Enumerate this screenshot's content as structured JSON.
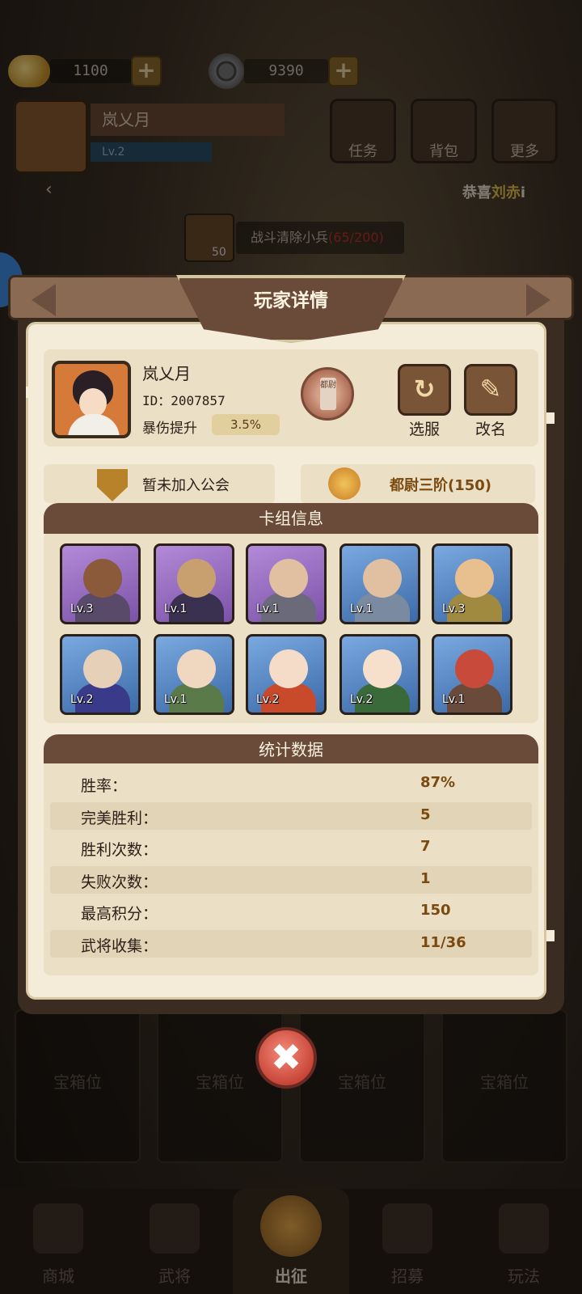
{
  "resources": {
    "gold": "1100",
    "coins": "9390",
    "plus": "+"
  },
  "player_bar": {
    "name": "岚乂月",
    "level": "Lv.2"
  },
  "top_buttons": {
    "task": "任务",
    "bag": "背包",
    "more": "更多"
  },
  "notice": {
    "prefix": "恭喜",
    "highlight": "刘赤",
    "suffix": "i",
    "left_arrow": "‹"
  },
  "quest": {
    "count": "50",
    "text": "战斗清除小兵",
    "progress": "(65/200)"
  },
  "dialog": {
    "title": "玩家详情",
    "player": {
      "name": "岚乂月",
      "id": "ID：2007857",
      "crit_label": "暴伤提升",
      "crit_value": "3.5%",
      "seal_text": "都尉"
    },
    "buttons": {
      "select_server": "选服",
      "rename": "改名",
      "select_server_icon": "↻",
      "rename_icon": "✎"
    },
    "guild": "暂未加入公会",
    "rank": "都尉三阶(150)",
    "deck": {
      "title": "卡组信息",
      "heroes": [
        {
          "level": "Lv.3",
          "rarity": "purple",
          "skin": "#8a5a3a",
          "armor": "#5a4a6a"
        },
        {
          "level": "Lv.1",
          "rarity": "purple",
          "skin": "#c8a070",
          "armor": "#3a3050"
        },
        {
          "level": "Lv.1",
          "rarity": "purple",
          "skin": "#e0c0a0",
          "armor": "#6a6a7a"
        },
        {
          "level": "Lv.1",
          "rarity": "blue",
          "skin": "#e0c0a0",
          "armor": "#7a8aa0"
        },
        {
          "level": "Lv.3",
          "rarity": "blue",
          "skin": "#e8c090",
          "armor": "#a08a40"
        },
        {
          "level": "Lv.2",
          "rarity": "blue",
          "skin": "#e6d0b8",
          "armor": "#3a3a8a"
        },
        {
          "level": "Lv.1",
          "rarity": "blue",
          "skin": "#f0d8c0",
          "armor": "#5a7a4a"
        },
        {
          "level": "Lv.2",
          "rarity": "blue",
          "skin": "#f4dcc8",
          "armor": "#c84a2a"
        },
        {
          "level": "Lv.2",
          "rarity": "blue",
          "skin": "#f6e0cc",
          "armor": "#3a6a3a"
        },
        {
          "level": "Lv.1",
          "rarity": "blue",
          "skin": "#c84a3a",
          "armor": "#6a4a3a"
        }
      ]
    },
    "stats": {
      "title": "统计数据",
      "rows": [
        {
          "label": "胜率：",
          "value": "87%"
        },
        {
          "label": "完美胜利：",
          "value": "5"
        },
        {
          "label": "胜利次数：",
          "value": "7"
        },
        {
          "label": "失败次数：",
          "value": "1"
        },
        {
          "label": "最高积分：",
          "value": "150"
        },
        {
          "label": "武将收集：",
          "value": "11/36"
        }
      ]
    },
    "close_icon": "✖"
  },
  "chests": [
    "宝箱位",
    "宝箱位",
    "宝箱位",
    "宝箱位"
  ],
  "nav": [
    {
      "label": "商城",
      "icon": "shop-icon",
      "active": false
    },
    {
      "label": "武将",
      "icon": "general-icon",
      "active": false
    },
    {
      "label": "出征",
      "icon": "battle-icon",
      "active": true
    },
    {
      "label": "招募",
      "icon": "recruit-icon",
      "active": false
    },
    {
      "label": "玩法",
      "icon": "play-icon",
      "active": false
    }
  ]
}
